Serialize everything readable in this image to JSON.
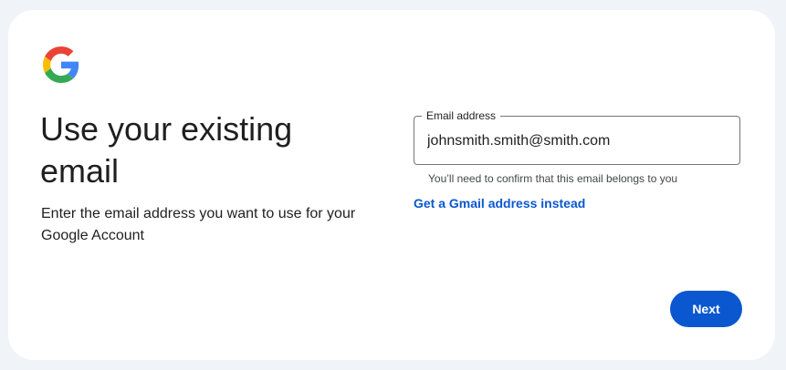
{
  "brand": {
    "logo_icon": "google-g-icon",
    "colors": {
      "blue": "#4285F4",
      "red": "#EA4335",
      "yellow": "#FBBC05",
      "green": "#34A853"
    }
  },
  "heading": {
    "title": "Use your existing email",
    "subtitle": "Enter the email address you want to use for your Google Account"
  },
  "email_field": {
    "label": "Email address",
    "value": "johnsmith.smith@smith.com",
    "helper": "You’ll need to confirm that this email belongs to you"
  },
  "alt_link": "Get a Gmail address instead",
  "next_button": "Next",
  "theme": {
    "accent": "#0b57d0",
    "page_background": "#f0f4f9"
  }
}
